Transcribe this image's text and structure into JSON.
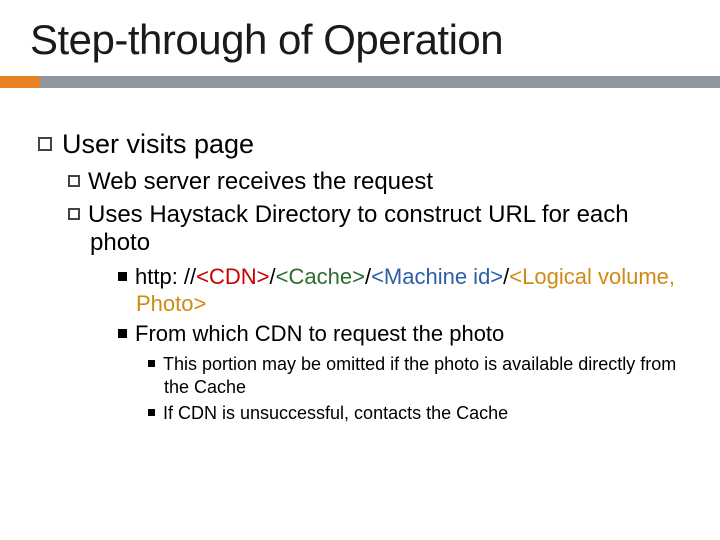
{
  "title": "Step-through of Operation",
  "colors": {
    "accent_orange": "#e98125",
    "accent_grey": "#9097a0",
    "cdn": "#cc0000",
    "cache": "#2f6b2f",
    "machine": "#2d5fa7",
    "volume": "#d08a14"
  },
  "lvl1": {
    "text": "User visits page"
  },
  "lvl2": [
    {
      "text": "Web server receives the request"
    },
    {
      "text": "Uses Haystack Directory to construct URL for each photo"
    }
  ],
  "url_line": {
    "prefix": "http: //",
    "cdn": "<CDN>",
    "sep": "/",
    "cache": "<Cache>",
    "machine": "<Machine id>",
    "volume": "<Logical volume, Photo>"
  },
  "lvl3b": {
    "text": "From which CDN to request the photo"
  },
  "lvl4": [
    {
      "text": "This portion may be omitted if the photo is available directly from the Cache"
    },
    {
      "text": "If CDN is unsuccessful, contacts the Cache"
    }
  ]
}
